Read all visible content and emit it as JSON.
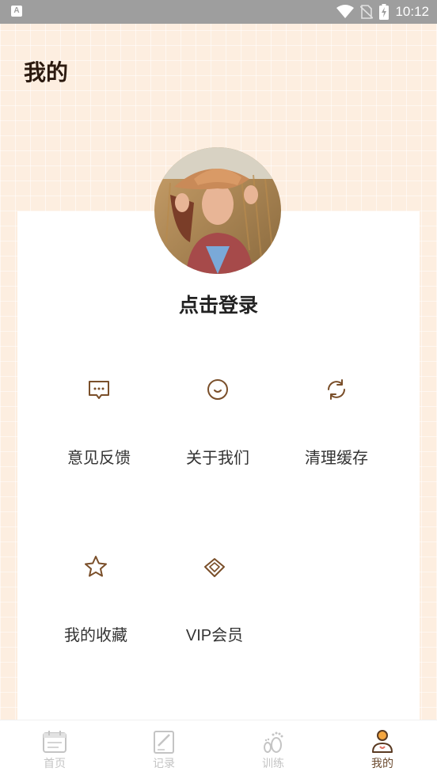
{
  "status_bar": {
    "time": "10:12",
    "left_icon_label": "A",
    "icons": [
      "wifi-icon",
      "no-sim-icon",
      "battery-charging-icon"
    ]
  },
  "header": {
    "title": "我的"
  },
  "profile": {
    "login_label": "点击登录",
    "avatar": "user-avatar-photo"
  },
  "menu": {
    "items": [
      {
        "label": "意见反馈",
        "icon": "feedback-icon"
      },
      {
        "label": "关于我们",
        "icon": "smile-icon"
      },
      {
        "label": "清理缓存",
        "icon": "refresh-icon"
      },
      {
        "label": "我的收藏",
        "icon": "star-icon"
      },
      {
        "label": "VIP会员",
        "icon": "diamond-icon"
      }
    ]
  },
  "bottom_nav": {
    "items": [
      {
        "label": "首页",
        "icon": "calendar-icon"
      },
      {
        "label": "记录",
        "icon": "edit-note-icon"
      },
      {
        "label": "训练",
        "icon": "footprints-icon"
      },
      {
        "label": "我的",
        "icon": "person-icon",
        "active": true
      }
    ]
  },
  "colors": {
    "background": "#fdeee0",
    "icon_brown": "#7a4f2a",
    "active_orange": "#f4a640",
    "text_dark": "#333333",
    "inactive_gray": "#c4c4c4"
  }
}
